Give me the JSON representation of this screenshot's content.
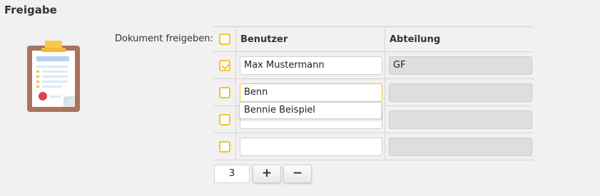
{
  "section": {
    "title": "Freigabe"
  },
  "form": {
    "label": "Dokument freigeben:"
  },
  "icon": {
    "name": "clipboard-icon"
  },
  "table": {
    "columns": [
      "Benutzer",
      "Abteilung"
    ],
    "rows": [
      {
        "checked": true,
        "user": "Max Mustermann",
        "department": "GF"
      },
      {
        "checked": false,
        "user": "Benn",
        "department": ""
      },
      {
        "checked": false,
        "user": "",
        "department": ""
      },
      {
        "checked": false,
        "user": "",
        "department": ""
      }
    ]
  },
  "autocomplete": {
    "suggestion": "Bennie Beispiel"
  },
  "pager": {
    "count": "3",
    "add_label": "+",
    "remove_label": "−"
  },
  "colors": {
    "accent": "#f2c136",
    "readonly_bg": "#dedede"
  }
}
